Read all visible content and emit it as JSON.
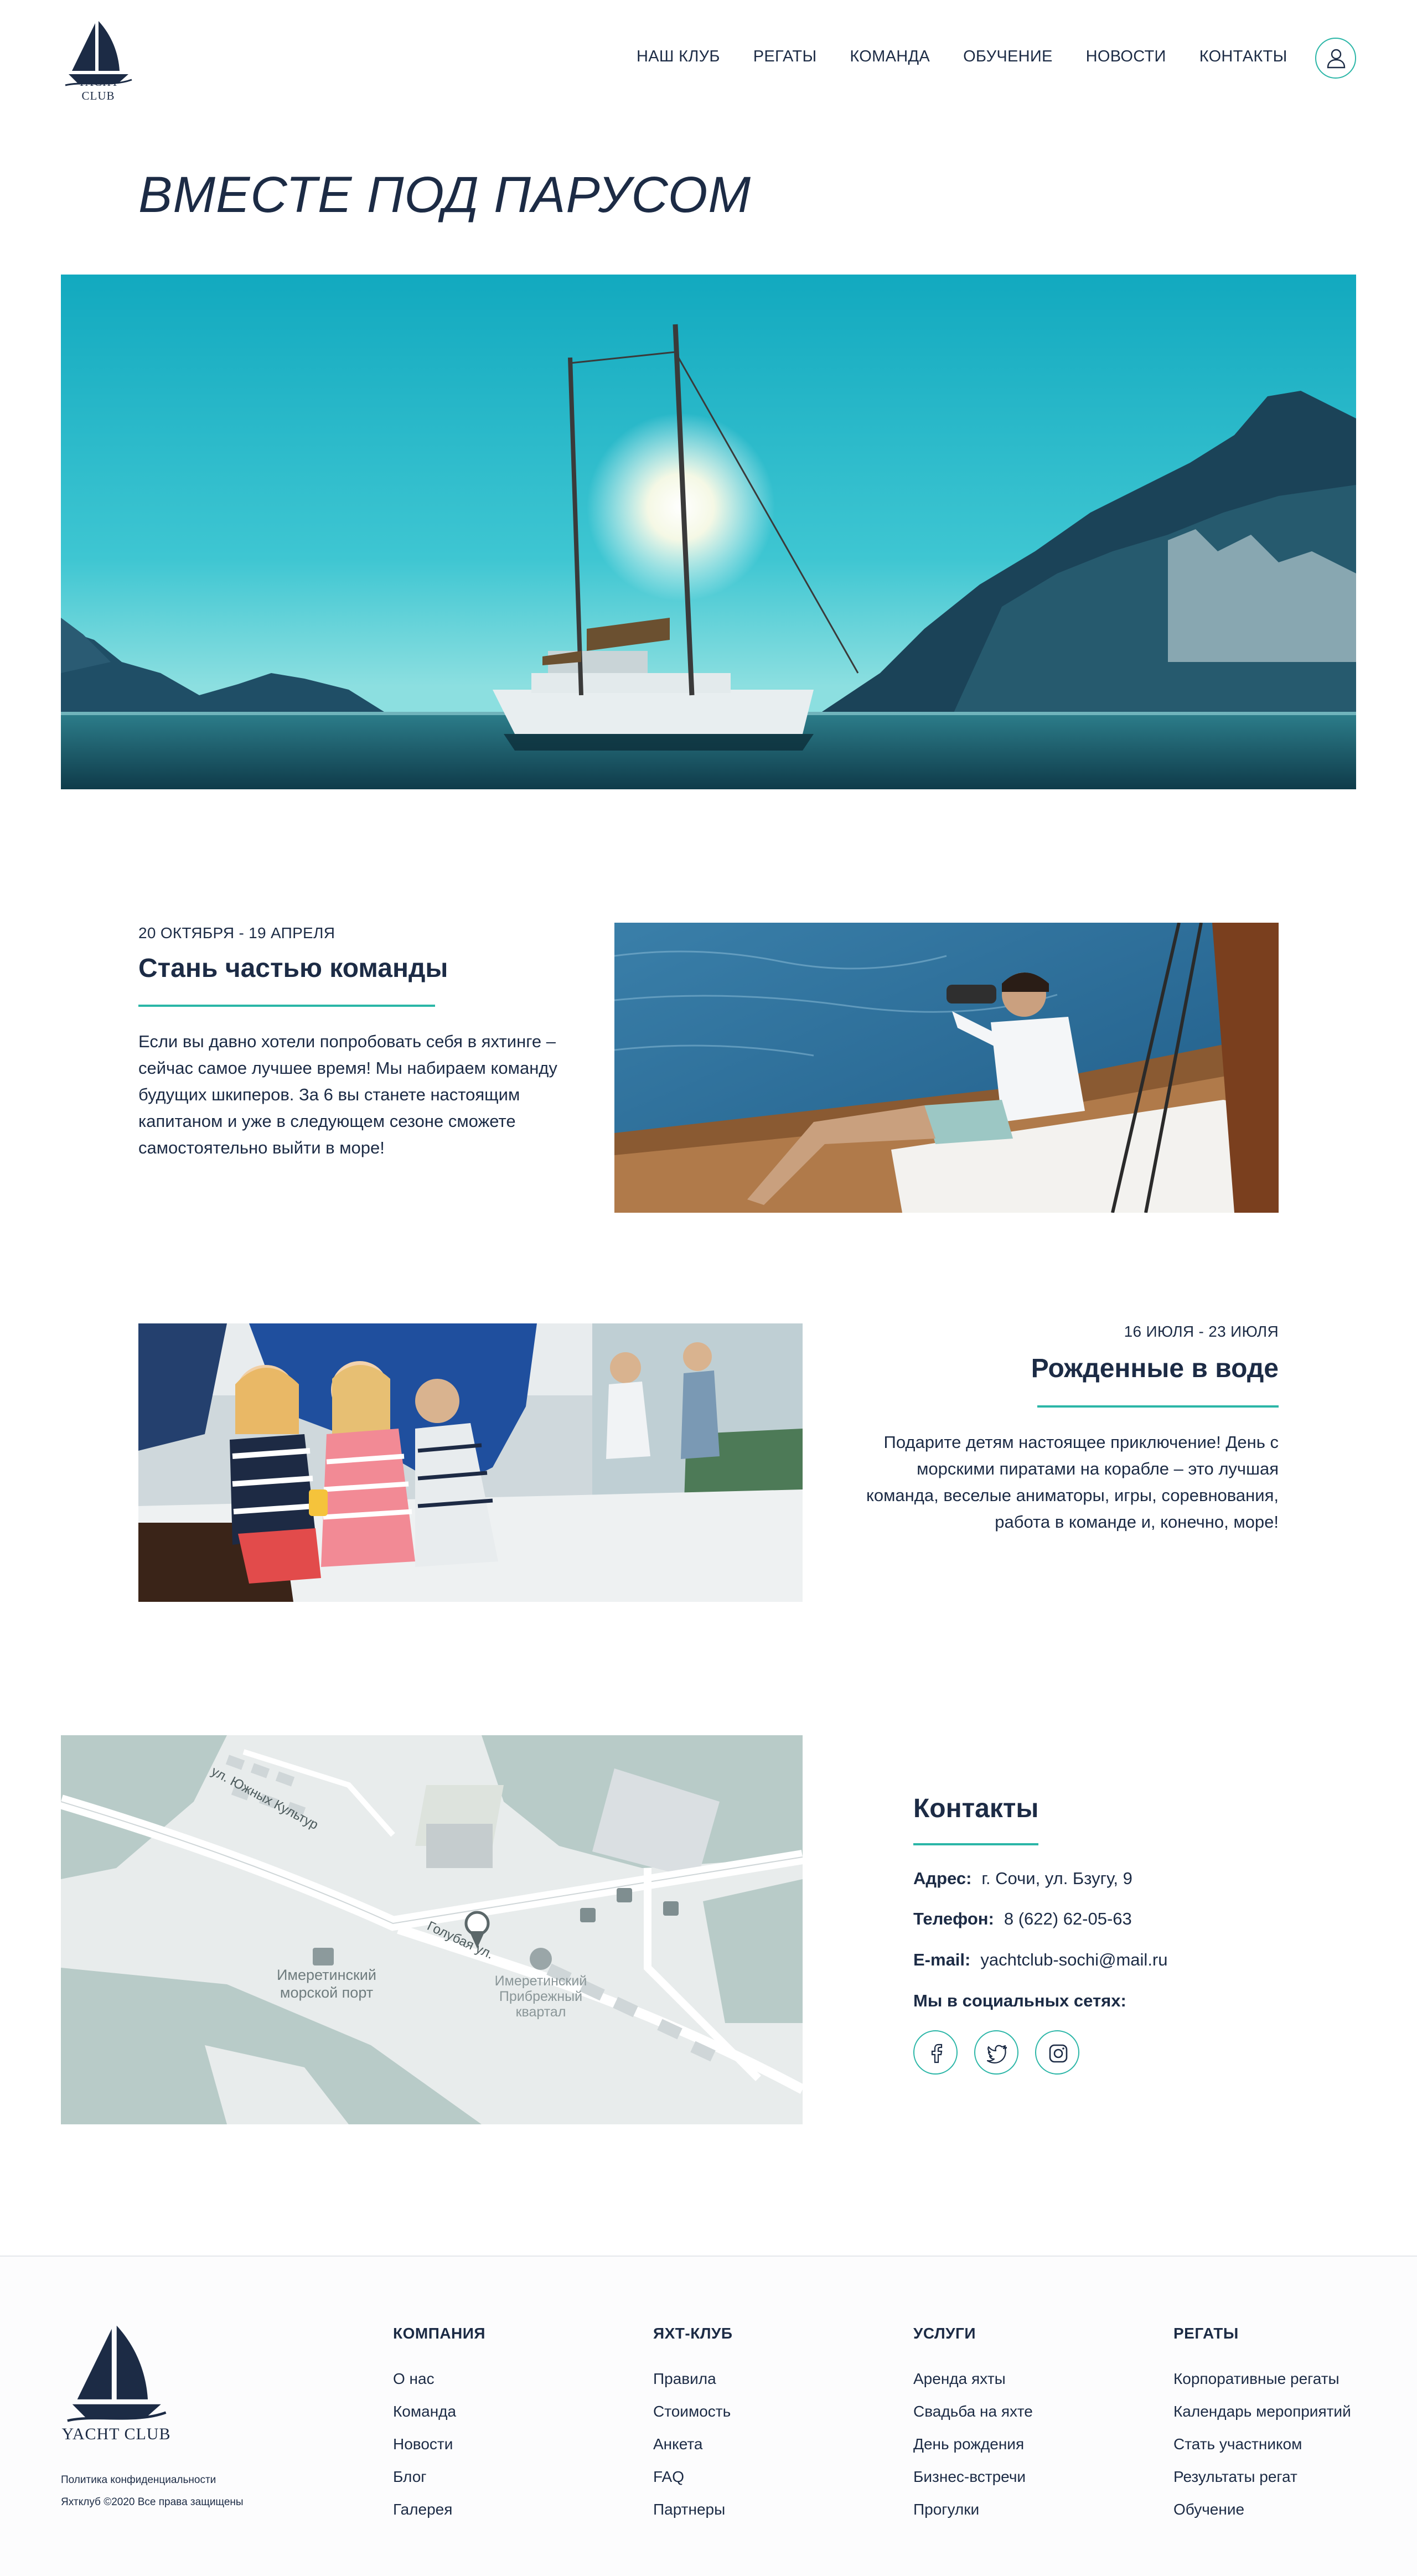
{
  "header": {
    "logo_text": "YACHT CLUB",
    "nav": [
      "НАШ КЛУБ",
      "РЕГАТЫ",
      "КОМАНДА",
      "ОБУЧЕНИЕ",
      "НОВОСТИ",
      "КОНТАКТЫ"
    ]
  },
  "hero": {
    "title": "ВМЕСТЕ ПОД ПАРУСОМ"
  },
  "events": [
    {
      "date": "20 ОКТЯБРЯ - 19 АПРЕЛЯ",
      "title": "Стань частью команды",
      "lines": [
        "Если вы давно хотели попробовать себя в яхтинге –",
        "сейчас самое лучшее время! Мы набираем команду",
        "будущих шкиперов. За 6 вы станете настоящим",
        "капитаном и уже в следующем сезоне сможете",
        "самостоятельно выйти в море!"
      ]
    },
    {
      "date": "16 ИЮЛЯ - 23 ИЮЛЯ",
      "title": "Рожденные в воде",
      "lines": [
        "Подарите детям настоящее приключение! День с",
        "морскими пиратами на корабле – это лучшая",
        "команда, веселые аниматоры, игры, соревнования,",
        "работа в команде и, конечно, море!"
      ]
    }
  ],
  "map": {
    "labels": [
      "ул. Южных Культур",
      "Голубая ул.",
      "Имеретинский",
      "морской порт",
      "Имеретинский",
      "Прибрежный",
      "квартал"
    ]
  },
  "contacts": {
    "title": "Контакты",
    "address_label": "Адрес:",
    "address": "г. Сочи, ул. Бзугу, 9",
    "phone_label": "Телефон:",
    "phone": "8 (622) 62-05-63",
    "email_label": "E-mail:",
    "email": "yachtclub-sochi@mail.ru",
    "social_label": "Мы в социальных сетях:",
    "social_icons": [
      "facebook-icon",
      "twitter-icon",
      "instagram-icon"
    ],
    "accent": "#2bb6a7"
  },
  "footer": {
    "logo_text": "YACHT CLUB",
    "privacy": "Политика конфиденциальности",
    "copyright": "Яхтклуб ©2020 Все права защищены",
    "columns": [
      {
        "title": "КОМПАНИЯ",
        "links": [
          "О нас",
          "Команда",
          "Новости",
          "Блог",
          "Галерея"
        ]
      },
      {
        "title": "ЯХТ-КЛУБ",
        "links": [
          "Правила",
          "Стоимость",
          "Анкета",
          "FAQ",
          "Партнеры"
        ]
      },
      {
        "title": "УСЛУГИ",
        "links": [
          "Аренда яхты",
          "Свадьба на яхте",
          "День рождения",
          "Бизнес-встречи",
          "Прогулки"
        ]
      },
      {
        "title": "РЕГАТЫ",
        "links": [
          "Корпоративные регаты",
          "Календарь мероприятий",
          "Стать участником",
          "Результаты регат",
          "Обучение"
        ]
      }
    ]
  }
}
